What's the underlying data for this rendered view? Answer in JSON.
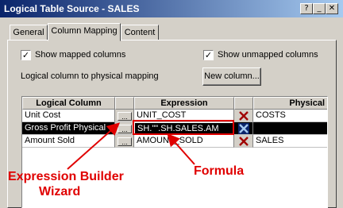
{
  "window": {
    "title": "Logical Table Source - SALES",
    "buttons": {
      "help": "?",
      "minimize": "_",
      "maximize": "□",
      "close": "✕"
    }
  },
  "tabs": [
    {
      "label": "General",
      "active": false
    },
    {
      "label": "Column Mapping",
      "active": true
    },
    {
      "label": "Content",
      "active": false
    }
  ],
  "options": {
    "show_mapped": {
      "label": "Show mapped columns",
      "checked": true
    },
    "show_unmapped": {
      "label": "Show unmapped columns",
      "checked": true
    }
  },
  "mapping_label": "Logical column to physical mapping",
  "new_column_button": "New column...",
  "table": {
    "headers": {
      "logical": "Logical Column",
      "expression": "Expression",
      "physical": "Physical"
    },
    "rows": [
      {
        "logical": "Unit Cost",
        "expression": "UNIT_COST",
        "physical": "COSTS",
        "selected": false
      },
      {
        "logical": "Gross Profit Physical",
        "expression": "SH.\"\".SH.SALES.AM",
        "physical": "",
        "selected": true
      },
      {
        "logical": "Amount Sold",
        "expression": "AMOUNT_SOLD",
        "physical": "SALES",
        "selected": false
      }
    ]
  },
  "annotations": {
    "expression_builder_line1": "Expression Builder",
    "expression_builder_line2": "Wizard",
    "formula": "Formula"
  },
  "colors": {
    "annotation": "#e00000",
    "title_bar": "#0a246a",
    "delete_icon": "#a00000"
  }
}
